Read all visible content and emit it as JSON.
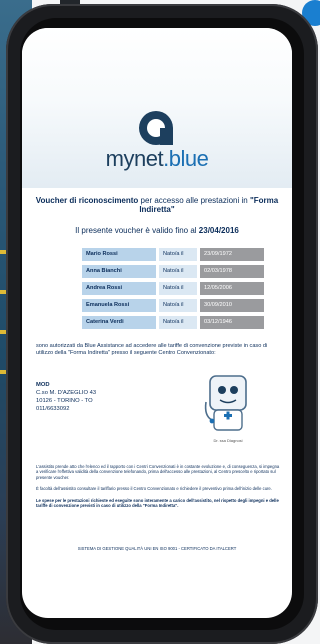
{
  "voucher": {
    "brand": {
      "part1": "mynet",
      "part2": ".blue"
    },
    "title": {
      "lead": "Voucher di riconoscimento",
      "middle": " per accesso alle prestazioni in ",
      "quoted": "\"Forma Indiretta\""
    },
    "validity": {
      "text": "Il presente voucher è valido fino al ",
      "date": "23/04/2016"
    },
    "people": [
      {
        "name": "Mario Rossi",
        "label": "Nato/a il",
        "date": "23/09/1972"
      },
      {
        "name": "Anna Bianchi",
        "label": "Nato/a il",
        "date": "02/03/1978"
      },
      {
        "name": "Andrea Rossi",
        "label": "Nato/a il",
        "date": "12/05/2006"
      },
      {
        "name": "Emanuela Rossi",
        "label": "Nato/a il",
        "date": "30/09/2010"
      },
      {
        "name": "Caterina Verdi",
        "label": "Nato/a il",
        "date": "03/12/1946"
      }
    ],
    "authorization": "sono autorizzati da Blue Assistance ad accedere alle tariffe di convenzione previste in caso di utilizzo della \"Forma Indiretta\" presso il seguente Centro Convenzionato:",
    "center": {
      "name": "MOD",
      "street": "C.so M. D'AZEGLIO 43",
      "city": "10126 - TORINO - TO",
      "phone": "011/6633092"
    },
    "mascot_caption": "Dr. ssa Diagnosi",
    "notes": [
      "L'assistito prende atto che l'elenco ed il rapporto con i Centri Convenzionati è in costante evoluzione e, di conseguenza, si impegna a verificare l'effettiva validità della convenzione telefonando, prima dell'accesso alle prestazioni, al Centro prescelto e riportato sul presente voucher.",
      "È facoltà dell'assistito consultare il tariffario presso il Centro Convenzionato e richiedere il preventivo prima dell'inizio delle cure.",
      "Le spese per le prestazioni richieste ed eseguite sono interamente a carico dell'assistito, nel rispetto degli impegni e delle tariffe di convenzione previsti in caso di utilizzo della \"Forma Indiretta\"."
    ],
    "footer": "SISTEMA DI GESTIONE QUALITÀ UNI EN ISO 9001 - CERTIFICATO DA ITALCERT"
  },
  "colors": {
    "navy": "#0b2d5a",
    "accent_blue": "#1b6fb3",
    "name_cell": "#b8d3ea",
    "date_cell": "#9a9b9e"
  }
}
